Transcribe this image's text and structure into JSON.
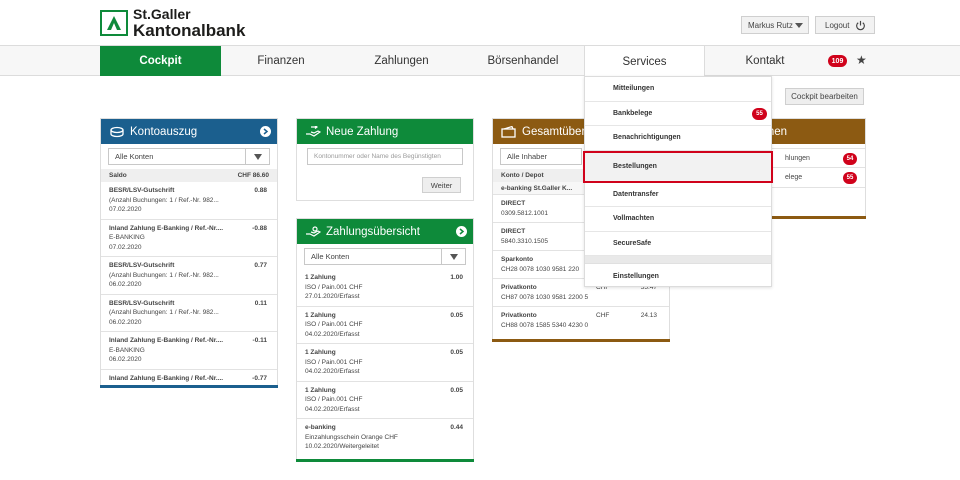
{
  "header": {
    "logo_line1": "St.Galler",
    "logo_line2": "Kantonalbank",
    "user_label": "Markus Rutz",
    "logout_label": "Logout"
  },
  "nav": {
    "items": [
      "Cockpit",
      "Finanzen",
      "Zahlungen",
      "Börsenhandel",
      "Services",
      "Kontakt"
    ],
    "badge": "109"
  },
  "cockpit_edit_label": "Cockpit bearbeiten",
  "kontoauszug": {
    "title": "Kontoauszug",
    "filter": "Alle Konten",
    "saldo_label": "Saldo",
    "saldo_value": "CHF 86.60",
    "rows": [
      {
        "title": "BESR/LSV-Gutschrift",
        "line2": "(Anzahl Buchungen: 1 / Ref.-Nr. 982...",
        "date": "07.02.2020",
        "amount": "0.88"
      },
      {
        "title": "Inland Zahlung E-Banking / Ref.-Nr....",
        "line2": "E-BANKING",
        "date": "07.02.2020",
        "amount": "-0.88"
      },
      {
        "title": "BESR/LSV-Gutschrift",
        "line2": "(Anzahl Buchungen: 1 / Ref.-Nr. 982...",
        "date": "06.02.2020",
        "amount": "0.77"
      },
      {
        "title": "BESR/LSV-Gutschrift",
        "line2": "(Anzahl Buchungen: 1 / Ref.-Nr. 982...",
        "date": "06.02.2020",
        "amount": "0.11"
      },
      {
        "title": "Inland Zahlung E-Banking / Ref.-Nr....",
        "line2": "E-BANKING",
        "date": "06.02.2020",
        "amount": "-0.11"
      },
      {
        "title": "Inland Zahlung E-Banking / Ref.-Nr....",
        "line2": "",
        "date": "",
        "amount": "-0.77"
      }
    ]
  },
  "neue_zahlung": {
    "title": "Neue Zahlung",
    "placeholder": "Kontonummer oder Name des Begünstigten",
    "button": "Weiter"
  },
  "zahlungsuebersicht": {
    "title": "Zahlungsübersicht",
    "filter": "Alle Konten",
    "rows": [
      {
        "title": "1 Zahlung",
        "line2": "ISO / Pain.001 CHF",
        "line3": "27.01.2020/Erfasst",
        "amount": "1.00"
      },
      {
        "title": "1 Zahlung",
        "line2": "ISO / Pain.001 CHF",
        "line3": "04.02.2020/Erfasst",
        "amount": "0.05"
      },
      {
        "title": "1 Zahlung",
        "line2": "ISO / Pain.001 CHF",
        "line3": "04.02.2020/Erfasst",
        "amount": "0.05"
      },
      {
        "title": "1 Zahlung",
        "line2": "ISO / Pain.001 CHF",
        "line3": "04.02.2020/Erfasst",
        "amount": "0.05"
      },
      {
        "title": "e-banking",
        "line2": "Einzahlungsschein Orange CHF",
        "line3": "10.02.2020/Weitergeleitet",
        "amount": "0.44"
      }
    ]
  },
  "gesamtuebersicht": {
    "title": "Gesamtübers",
    "filter": "Alle Inhaber",
    "subhead": "Konto / Depot",
    "group": "e-banking St.Galler K...",
    "rows": [
      {
        "title": "DIRECT",
        "line2": "0309.5812.1001",
        "cur": "",
        "amount": ""
      },
      {
        "title": "DIRECT",
        "line2": "5840.3310.1505",
        "cur": "",
        "amount": ""
      },
      {
        "title": "Sparkonto",
        "line2": "CH28 0078 1030 9581 220",
        "cur": "",
        "amount": ""
      },
      {
        "title": "Privatkonto",
        "line2": "CH87 0078 1030 9581 2200 5",
        "cur": "CHF",
        "amount": "55.47"
      },
      {
        "title": "Privatkonto",
        "line2": "CH88 0078 1585 5340 4230 0",
        "cur": "CHF",
        "amount": "24.13"
      }
    ]
  },
  "nachrichten": {
    "title": "hen",
    "rows": [
      {
        "label": "hlungen",
        "badge": "54"
      },
      {
        "label": "elege",
        "badge": "55"
      }
    ]
  },
  "services_menu": {
    "items": [
      {
        "label": "Mitteilungen",
        "badge": ""
      },
      {
        "label": "Bankbelege",
        "badge": "55"
      },
      {
        "label": "Benachrichtigungen",
        "badge": ""
      },
      {
        "label": "Bestellungen",
        "badge": ""
      },
      {
        "label": "Datentransfer",
        "badge": ""
      },
      {
        "label": "Vollmachten",
        "badge": ""
      },
      {
        "label": "SecureSafe",
        "badge": ""
      },
      {
        "label": "Einstellungen",
        "badge": ""
      }
    ]
  },
  "colors": {
    "green": "#0e8a3a",
    "blue": "#1b5f8e",
    "brown": "#8c5a12",
    "red": "#d0021b"
  }
}
